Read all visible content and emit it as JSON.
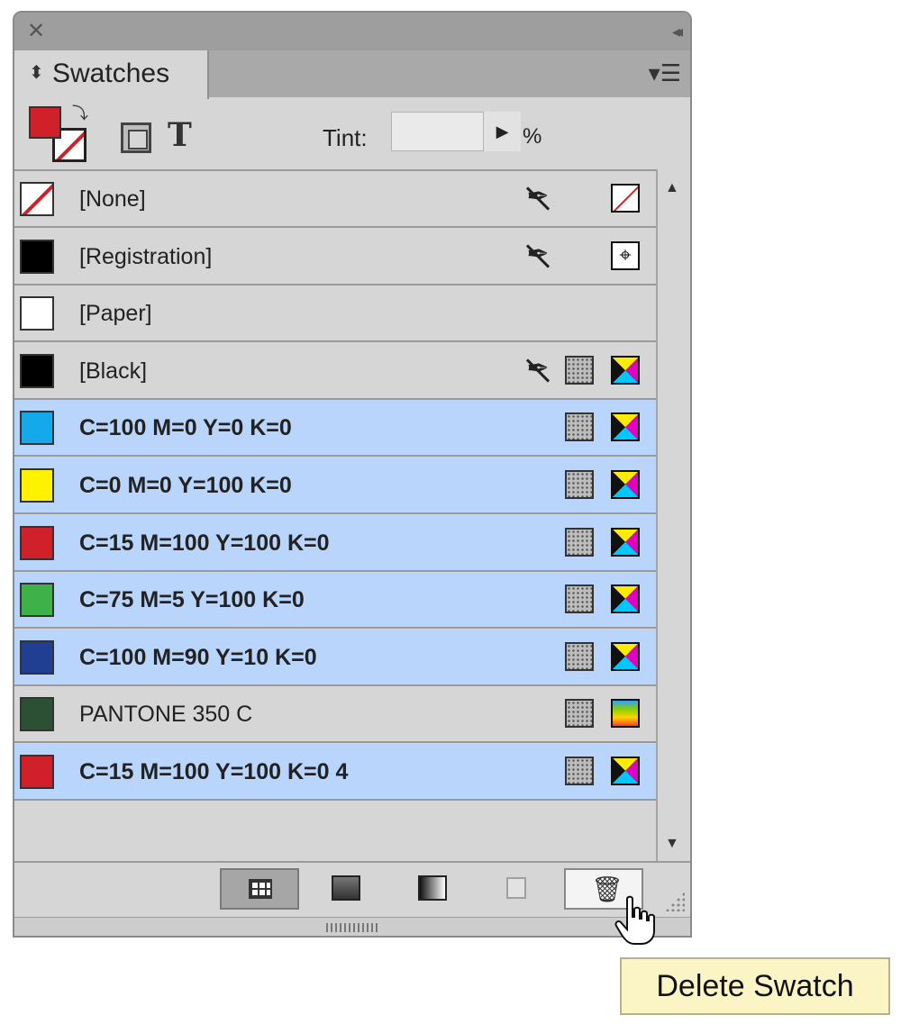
{
  "panel": {
    "title_controls": {
      "close_glyph": "✕",
      "collapse_glyph": "◂◂"
    },
    "tab_label": "Swatches",
    "tab_toggle_glyph": "⬍",
    "menu_glyph": "▾☰"
  },
  "toolbar": {
    "fill_color": "#d0202a",
    "text_glyph": "T",
    "tint_label": "Tint:",
    "tint_value": "",
    "tint_arrow_glyph": "▶",
    "tint_unit": "%"
  },
  "swatches": [
    {
      "name": "[None]",
      "chip_color": "none",
      "selected": false,
      "edit_locked": true,
      "process_icon": false,
      "mode_icon": "none"
    },
    {
      "name": "[Registration]",
      "chip_color": "#000000",
      "selected": false,
      "edit_locked": true,
      "process_icon": false,
      "mode_icon": "registration"
    },
    {
      "name": "[Paper]",
      "chip_color": "#ffffff",
      "selected": false,
      "edit_locked": false,
      "process_icon": false,
      "mode_icon": ""
    },
    {
      "name": "[Black]",
      "chip_color": "#000000",
      "selected": false,
      "edit_locked": true,
      "process_icon": true,
      "mode_icon": "cmyk"
    },
    {
      "name": "C=100 M=0 Y=0 K=0",
      "chip_color": "#14a9eb",
      "selected": true,
      "edit_locked": false,
      "process_icon": true,
      "mode_icon": "cmyk"
    },
    {
      "name": "C=0 M=0 Y=100 K=0",
      "chip_color": "#fff200",
      "selected": true,
      "edit_locked": false,
      "process_icon": true,
      "mode_icon": "cmyk"
    },
    {
      "name": "C=15 M=100 Y=100 K=0",
      "chip_color": "#d0202a",
      "selected": true,
      "edit_locked": false,
      "process_icon": true,
      "mode_icon": "cmyk"
    },
    {
      "name": "C=75 M=5 Y=100 K=0",
      "chip_color": "#3fb149",
      "selected": true,
      "edit_locked": false,
      "process_icon": true,
      "mode_icon": "cmyk"
    },
    {
      "name": "C=100 M=90 Y=10 K=0",
      "chip_color": "#213f92",
      "selected": true,
      "edit_locked": false,
      "process_icon": true,
      "mode_icon": "cmyk"
    },
    {
      "name": "PANTONE 350 C",
      "chip_color": "#2b5033",
      "selected": false,
      "edit_locked": false,
      "process_icon": true,
      "mode_icon": "spot"
    },
    {
      "name": "C=15 M=100 Y=100 K=0 4",
      "chip_color": "#d0202a",
      "selected": true,
      "edit_locked": false,
      "process_icon": true,
      "mode_icon": "cmyk"
    }
  ],
  "scroll": {
    "up_glyph": "▲",
    "down_glyph": "▼"
  },
  "bottom_bar": {
    "delete_glyph": "🗑"
  },
  "tooltip": "Delete Swatch",
  "colors": {
    "selection": "#b9d5fb",
    "panel_bg": "#d6d6d6",
    "tooltip_bg": "#fbf4c4"
  }
}
